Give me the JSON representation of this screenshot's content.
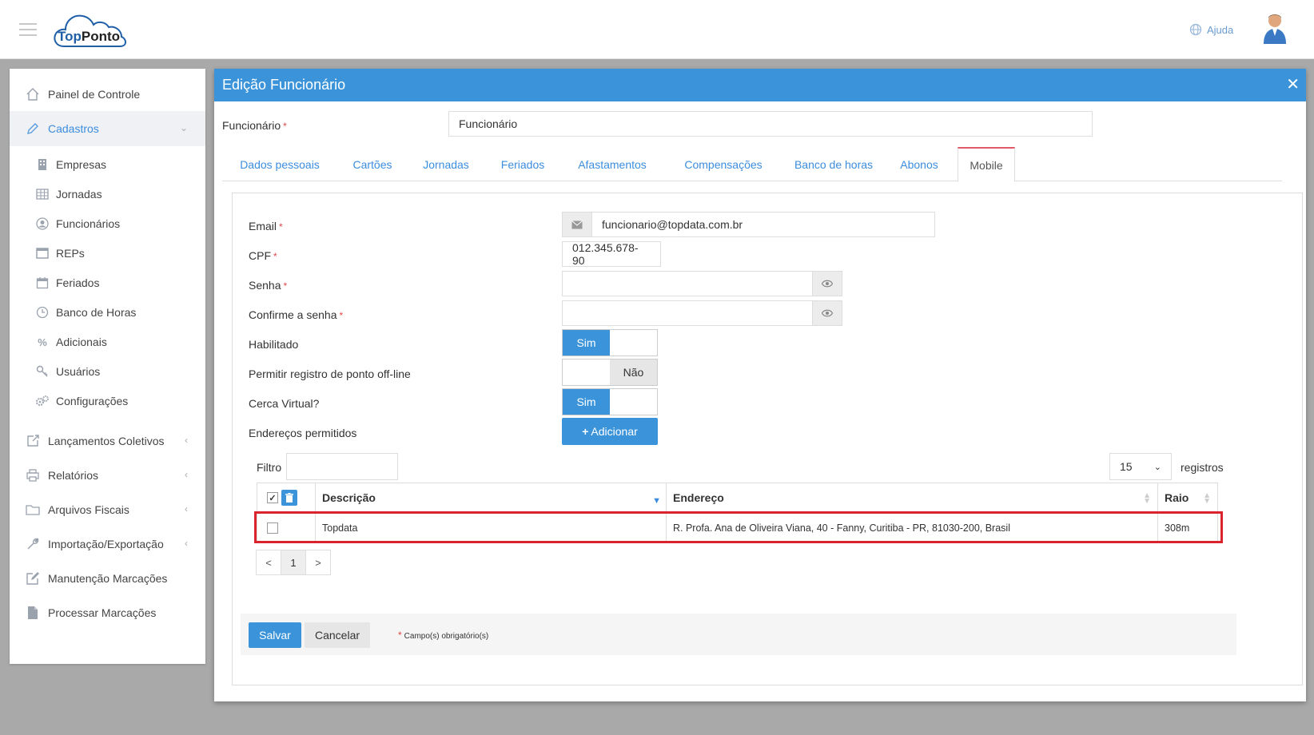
{
  "topbar": {
    "logo_top": "Top",
    "logo_ponto": "Ponto",
    "help_label": "Ajuda"
  },
  "sidebar": {
    "painel": "Painel de Controle",
    "cadastros": "Cadastros",
    "sub": {
      "empresas": "Empresas",
      "jornadas": "Jornadas",
      "funcionarios": "Funcionários",
      "reps": "REPs",
      "feriados": "Feriados",
      "banco_horas": "Banco de Horas",
      "adicionais": "Adicionais",
      "usuarios": "Usuários",
      "configuracoes": "Configurações"
    },
    "lancamentos": "Lançamentos Coletivos",
    "relatorios": "Relatórios",
    "arquivos": "Arquivos Fiscais",
    "importacao": "Importação/Exportação",
    "manutencao": "Manutenção Marcações",
    "processar": "Processar Marcações"
  },
  "modal": {
    "title": "Edição Funcionário",
    "funcionario_label": "Funcionário",
    "funcionario_value": "Funcionário",
    "tabs": {
      "dados": "Dados pessoais",
      "cartoes": "Cartões",
      "jornadas": "Jornadas",
      "feriados": "Feriados",
      "afastamentos": "Afastamentos",
      "compensacoes": "Compensações",
      "banco": "Banco de horas",
      "abonos": "Abonos",
      "mobile": "Mobile"
    },
    "form": {
      "email_label": "Email",
      "email_value": "funcionario@topdata.com.br",
      "cpf_label": "CPF",
      "cpf_value": "012.345.678-90",
      "senha_label": "Senha",
      "confirme_label": "Confirme a senha",
      "habilitado_label": "Habilitado",
      "habilitado_value": "Sim",
      "offline_label": "Permitir registro de ponto off-line",
      "offline_value": "Não",
      "cerca_label": "Cerca Virtual?",
      "cerca_value": "Sim",
      "enderecos_label": "Endereços permitidos",
      "adicionar_label": "Adicionar"
    },
    "table": {
      "filtro_label": "Filtro",
      "page_size": "15",
      "registros_label": "registros",
      "col_descricao": "Descrição",
      "col_endereco": "Endereço",
      "col_raio": "Raio",
      "rows": [
        {
          "descricao": "Topdata",
          "endereco": "R. Profa. Ana de Oliveira Viana, 40 - Fanny, Curitiba - PR, 81030-200, Brasil",
          "raio": "308m"
        }
      ],
      "pager_prev": "<",
      "pager_page": "1",
      "pager_next": ">"
    },
    "footer": {
      "salvar": "Salvar",
      "cancelar": "Cancelar",
      "required_note": "Campo(s) obrigatório(s)"
    }
  },
  "colors": {
    "primary": "#3b94da",
    "highlight": "#d9232d",
    "required": "#e04848"
  }
}
